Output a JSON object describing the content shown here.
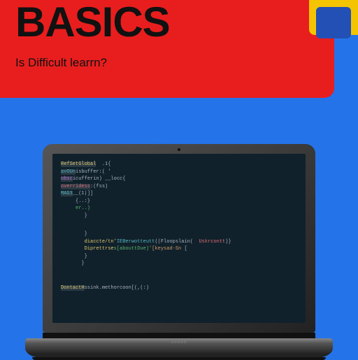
{
  "header": {
    "title": "BASICS",
    "subtitle": "Is Difficult learrn?"
  },
  "laptop": {
    "brand": "○○○○○"
  },
  "code": {
    "lines": [
      [
        {
          "t": "RefSetGlobal",
          "c": "c-fn c-bg"
        },
        {
          "t": "  .1{",
          "c": "c-punc"
        }
      ],
      [
        {
          "t": "avOUn",
          "c": "c-var c-bg"
        },
        {
          "t": "isbuffer:( '",
          "c": "c-punc"
        }
      ],
      [
        {
          "t": "obsc",
          "c": "c-kw c-bg"
        },
        {
          "t": "icufferin) __locc{",
          "c": "c-punc"
        }
      ],
      [
        {
          "t": "overridess",
          "c": "c-err c-bg"
        },
        {
          "t": ":(fss)",
          "c": "c-punc"
        }
      ],
      [
        {
          "t": "MAS3",
          "c": "c-var c-bg"
        },
        {
          "t": "__(1|]]",
          "c": "c-punc"
        }
      ],
      [
        {
          "t": "     {..:}",
          "c": "c-punc"
        }
      ],
      [
        {
          "t": "     er..)",
          "c": "c-str"
        }
      ],
      [
        {
          "t": "        }",
          "c": "c-punc"
        }
      ],
      [
        {
          "t": "",
          "c": ""
        }
      ],
      [
        {
          "t": "",
          "c": ""
        }
      ],
      [
        {
          "t": "        }",
          "c": "c-punc"
        }
      ],
      [
        {
          "t": "        ",
          "c": ""
        },
        {
          "t": "diaccte/tn'",
          "c": "c-fn"
        },
        {
          "t": "IEBerwotteutt",
          "c": "c-var"
        },
        {
          "t": "((Floopslain(  ",
          "c": "c-punc"
        },
        {
          "t": "Uskrcontt",
          "c": "c-err"
        },
        {
          "t": ")}",
          "c": "c-punc"
        }
      ],
      [
        {
          "t": "        ",
          "c": ""
        },
        {
          "t": "Diprettrse",
          "c": "c-fn"
        },
        {
          "t": "s[abouttDue)'",
          "c": "c-str"
        },
        {
          "t": "[keysad-Sn",
          "c": "c-num"
        },
        {
          "t": " [",
          "c": "c-punc"
        }
      ],
      [
        {
          "t": "        ",
          "c": ""
        },
        {
          "t": "}",
          "c": "c-punc"
        }
      ],
      [
        {
          "t": "       }",
          "c": "c-punc"
        }
      ],
      [
        {
          "t": "",
          "c": ""
        }
      ],
      [
        {
          "t": "",
          "c": ""
        }
      ],
      [
        {
          "t": "",
          "c": ""
        }
      ],
      [
        {
          "t": "DontactH",
          "c": "c-fn c-bg"
        },
        {
          "t": "ssink.methorcoon[(,(:)",
          "c": "c-punc"
        }
      ]
    ]
  }
}
